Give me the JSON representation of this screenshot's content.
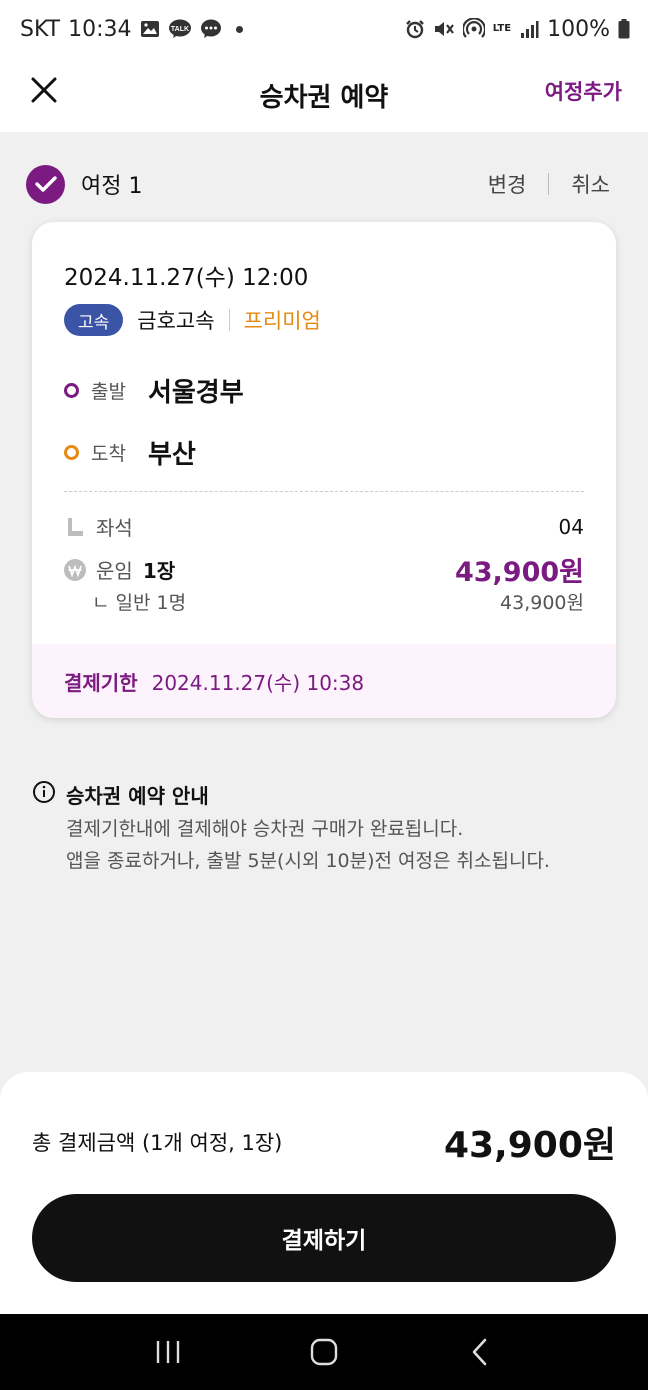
{
  "status_bar": {
    "carrier": "SKT",
    "time": "10:34",
    "battery": "100%",
    "network": "LTE"
  },
  "header": {
    "title": "승차권 예약",
    "add_trip": "여정추가"
  },
  "trip": {
    "label": "여정 1",
    "change": "변경",
    "cancel": "취소",
    "datetime": "2024.11.27(수) 12:00",
    "badge": "고속",
    "company": "금호고속",
    "grade": "프리미엄",
    "departure_label": "출발",
    "departure": "서울경부",
    "arrival_label": "도착",
    "arrival": "부산",
    "seat_label": "좌석",
    "seat": "04",
    "fare_label": "운임",
    "fare_count": "1장",
    "fare_total": "43,900원",
    "fare_sub_label": "ㄴ 일반 1명",
    "fare_sub": "43,900원",
    "deadline_label": "결제기한",
    "deadline": "2024.11.27(수) 10:38"
  },
  "notice": {
    "title": "승차권 예약 안내",
    "line1": "결제기한내에 결제해야 승차권 구매가 완료됩니다.",
    "line2": "앱을 종료하거나, 출발 5분(시외 10분)전 여정은 취소됩니다."
  },
  "summary": {
    "total_label": "총 결제금액 (1개 여정, 1장)",
    "total_amount": "43,900원",
    "pay_button": "결제하기"
  },
  "colors": {
    "accent": "#7b1a80",
    "orange": "#e58a12",
    "badge_blue": "#3a55a6"
  }
}
